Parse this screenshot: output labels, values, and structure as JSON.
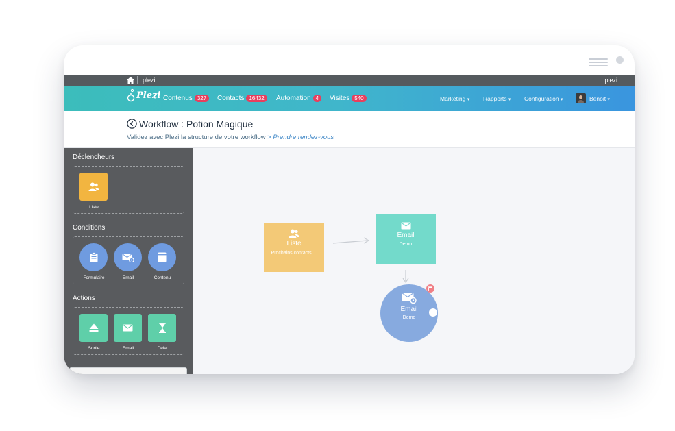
{
  "topbar": {
    "brand": "plezi",
    "user": "plezi"
  },
  "navbar": {
    "logo_text": "Plezi",
    "items": [
      {
        "label": "Contenus",
        "count": "327"
      },
      {
        "label": "Contacts",
        "count": "16432"
      },
      {
        "label": "Automation",
        "count": "4"
      },
      {
        "label": "Visites",
        "count": "540"
      }
    ],
    "right": [
      {
        "label": "Marketing"
      },
      {
        "label": "Rapports"
      },
      {
        "label": "Configuration"
      },
      {
        "label": "Benoit"
      }
    ]
  },
  "header": {
    "title": "Workflow : Potion Magique",
    "subtitle": "Validez avec Plezi la structure de votre workflow",
    "subtitle_link": "> Prendre rendez-vous"
  },
  "sidebar": {
    "triggers": {
      "title": "Déclencheurs",
      "items": [
        {
          "label": "Liste",
          "icon": "users-icon"
        }
      ]
    },
    "conditions": {
      "title": "Conditions",
      "items": [
        {
          "label": "Formulaire",
          "icon": "clipboard-icon"
        },
        {
          "label": "Email",
          "icon": "email-settings-icon"
        },
        {
          "label": "Contenu",
          "icon": "book-icon"
        }
      ]
    },
    "actions": {
      "title": "Actions",
      "items": [
        {
          "label": "Sortie",
          "icon": "eject-icon"
        },
        {
          "label": "Email",
          "icon": "envelope-icon"
        },
        {
          "label": "Délai",
          "icon": "hourglass-icon"
        }
      ]
    }
  },
  "canvas": {
    "nodes": [
      {
        "title": "Liste",
        "subtitle": "Prochains contacts ..."
      },
      {
        "title": "Email",
        "subtitle": "Demo"
      },
      {
        "title": "Email",
        "subtitle": "Demo"
      }
    ]
  },
  "colors": {
    "trigger": "#f2b540",
    "condition": "#6f9be0",
    "action": "#5fcfa9",
    "badge": "#e83f5e",
    "nav_start": "#3cbdbb",
    "nav_end": "#3a95df"
  }
}
